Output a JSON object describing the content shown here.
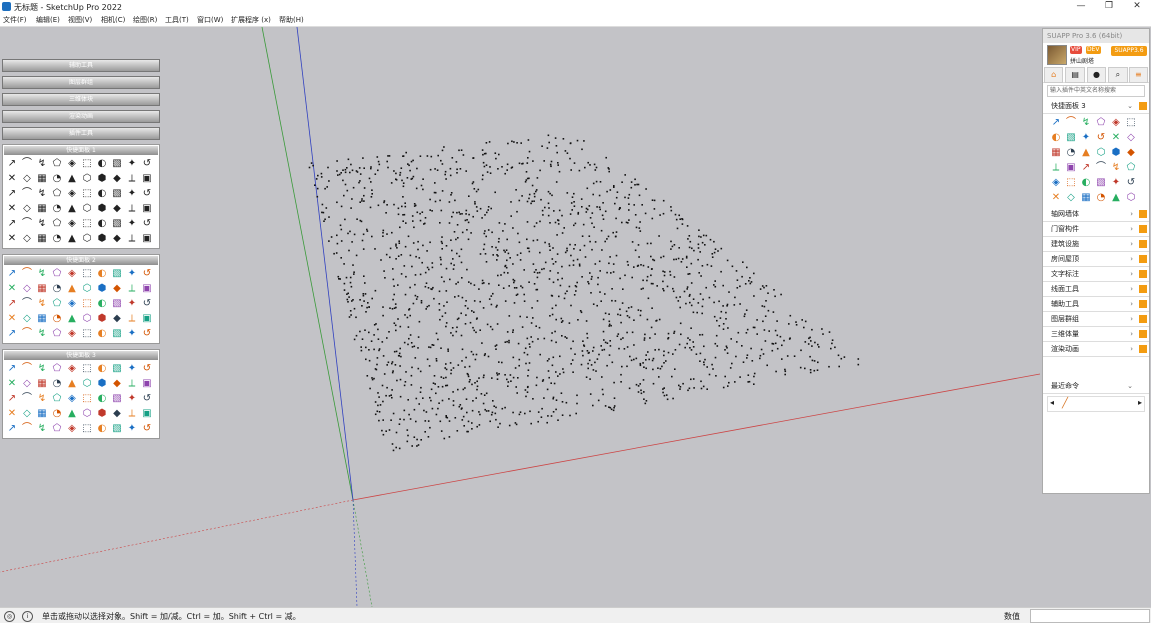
{
  "window": {
    "title": "无标题 - SketchUp Pro 2022",
    "controls": [
      "—",
      "❐",
      "✕"
    ]
  },
  "menubar": [
    {
      "label": "文件(F)"
    },
    {
      "label": "编辑(E)"
    },
    {
      "label": "视图(V)"
    },
    {
      "label": "相机(C)"
    },
    {
      "label": "绘图(R)"
    },
    {
      "label": "工具(T)"
    },
    {
      "label": "窗口(W)"
    },
    {
      "label": "扩展程序 (x)"
    },
    {
      "label": "帮助(H)"
    }
  ],
  "left_panel": {
    "tray_headers": [
      "辅助工具",
      "图层群组",
      "三维体块",
      "渲染动画",
      "插件工具"
    ],
    "toolbars": [
      {
        "title": "快捷面板 1"
      },
      {
        "title": "快捷面板 2"
      },
      {
        "title": "快捷面板 3"
      }
    ]
  },
  "right_panel": {
    "title": "SUAPP Pro 3.6 (64bit)",
    "badges": [
      "VIP",
      "DEV"
    ],
    "button": "SUAPP3.6",
    "username": "拼山剧塔",
    "search_placeholder": "输入插件中英文名称搜索",
    "quick_panel": "快捷面板 3",
    "sections": [
      "轴网墙体",
      "门窗构件",
      "建筑设施",
      "房间屋顶",
      "文字标注",
      "线面工具",
      "辅助工具",
      "图层群组",
      "三维体量",
      "渲染动画"
    ],
    "recent_label": "最近命令"
  },
  "status": {
    "message": "单击或拖动以选择对象。Shift = 加/减。Ctrl = 加。Shift + Ctrl = 减。",
    "value_label": "数值",
    "value": ""
  },
  "colors": {
    "viewport_bg": "#c3c3c7",
    "axis_red": "#c44",
    "axis_green": "#3a9a3a",
    "axis_blue": "#3040c0",
    "points": "#111111",
    "accent": "#f39c12"
  }
}
